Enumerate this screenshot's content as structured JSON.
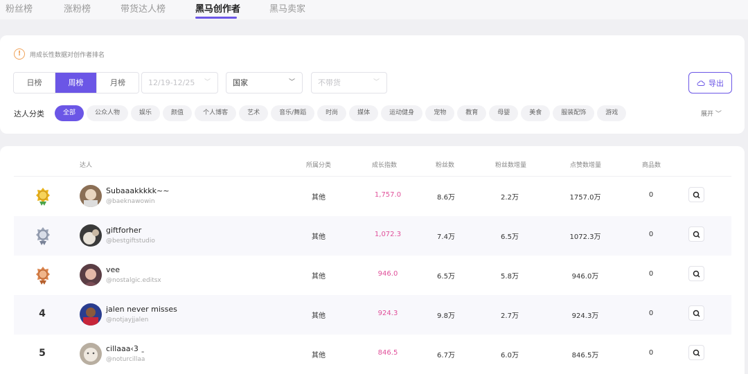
{
  "top_tabs": [
    {
      "label": "粉丝榜"
    },
    {
      "label": "涨粉榜"
    },
    {
      "label": "带货达人榜"
    },
    {
      "label": "黑马创作者"
    },
    {
      "label": "黑马卖家"
    }
  ],
  "notice": "用成长性数据对创作者排名",
  "periods": [
    "日榜",
    "周榜",
    "月榜"
  ],
  "date_select": "12/19-12/25",
  "country_select": "国家",
  "goods_select": "不带货",
  "export_label": "导出",
  "category_label": "达人分类",
  "categories": [
    "全部",
    "公众人物",
    "娱乐",
    "颜值",
    "个人博客",
    "艺术",
    "音乐/舞蹈",
    "时尚",
    "媒体",
    "运动健身",
    "宠物",
    "教育",
    "母婴",
    "美食",
    "服装配饰",
    "游戏"
  ],
  "expand_label": "展开",
  "table": {
    "headers": {
      "creator": "达人",
      "category": "所属分类",
      "growth": "成长指数",
      "fans": "粉丝数",
      "fans_inc": "粉丝数增量",
      "likes_inc": "点赞数增量",
      "products": "商品数"
    },
    "rows": [
      {
        "rank": "1",
        "name": "Subaaakkkkk~~",
        "handle": "@baeknawowin",
        "category": "其他",
        "growth": "1,757.0",
        "fans": "8.6万",
        "fans_inc": "2.2万",
        "likes_inc": "1757.0万",
        "products": "0"
      },
      {
        "rank": "2",
        "name": "giftforher",
        "handle": "@bestgiftstudio",
        "category": "其他",
        "growth": "1,072.3",
        "fans": "7.4万",
        "fans_inc": "6.5万",
        "likes_inc": "1072.3万",
        "products": "0"
      },
      {
        "rank": "3",
        "name": "vee",
        "handle": "@nostalgic.editsx",
        "category": "其他",
        "growth": "946.0",
        "fans": "6.5万",
        "fans_inc": "5.8万",
        "likes_inc": "946.0万",
        "products": "0"
      },
      {
        "rank": "4",
        "name": "jalen never misses",
        "handle": "@notjayjjalen",
        "category": "其他",
        "growth": "924.3",
        "fans": "9.8万",
        "fans_inc": "2.7万",
        "likes_inc": "924.3万",
        "products": "0"
      },
      {
        "rank": "5",
        "name": "cillaaa‹3 ˍ",
        "handle": "@noturcillaa",
        "category": "其他",
        "growth": "846.5",
        "fans": "6.7万",
        "fans_inc": "6.0万",
        "likes_inc": "846.5万",
        "products": "0"
      }
    ]
  },
  "colors": {
    "accent": "#6b56e6",
    "growth": "#e0509a",
    "gold": "#e8b21a",
    "silver": "#9aa3b5",
    "bronze": "#d9824a"
  }
}
